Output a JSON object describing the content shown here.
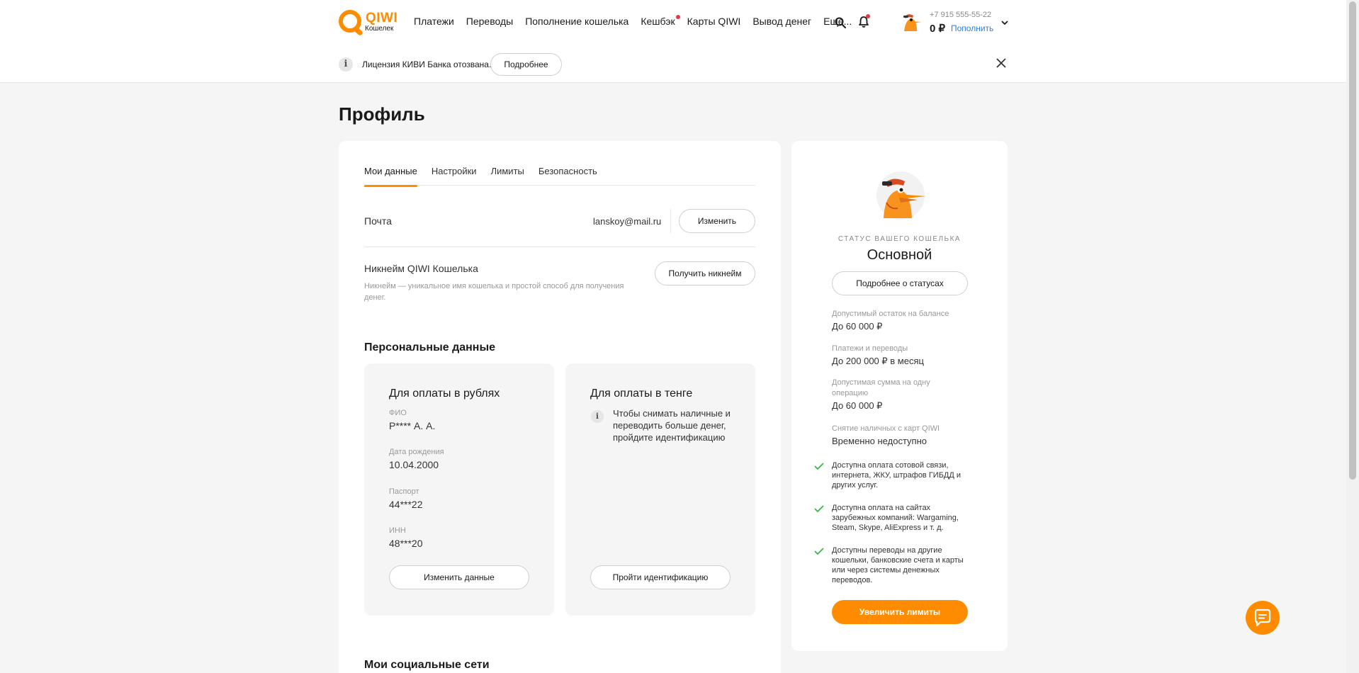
{
  "header": {
    "logo_text": "QIWI",
    "logo_sub": "Кошелек",
    "nav": [
      {
        "label": "Платежи",
        "dot": false
      },
      {
        "label": "Переводы",
        "dot": false
      },
      {
        "label": "Пополнение кошелька",
        "dot": false
      },
      {
        "label": "Кешбэк",
        "dot": true
      },
      {
        "label": "Карты QIWI",
        "dot": false
      },
      {
        "label": "Вывод денег",
        "dot": false
      },
      {
        "label": "Еще...",
        "dot": false
      }
    ],
    "search_icon": "search-icon",
    "bell_icon": "bell-icon",
    "phone": "+7 915 555-55-22",
    "balance": "0 ₽",
    "topup_label": "Пополнить"
  },
  "notice": {
    "text": "Лицензия КИВИ Банка отозвана.",
    "button": "Подробнее"
  },
  "page": {
    "title": "Профиль"
  },
  "tabs": [
    "Мои данные",
    "Настройки",
    "Лимиты",
    "Безопасность"
  ],
  "active_tab": "Мои данные",
  "email": {
    "label": "Почта",
    "value": "lanskoy@mail.ru",
    "button": "Изменить"
  },
  "nickname": {
    "label": "Никнейм QIWI Кошелька",
    "description": "Никнейм — уникальное имя кошелька и простой способ для получения денег.",
    "button": "Получить никнейм"
  },
  "personal": {
    "title": "Персональные данные",
    "rub": {
      "title": "Для оплаты в рублях",
      "fields": [
        {
          "label": "ФИО",
          "value": "Р**** А. А."
        },
        {
          "label": "Дата рождения",
          "value": "10.04.2000"
        },
        {
          "label": "Паспорт",
          "value": "44***22"
        },
        {
          "label": "ИНН",
          "value": "48***20"
        }
      ],
      "button": "Изменить данные"
    },
    "kzt": {
      "title": "Для оплаты в тенге",
      "info": "Чтобы снимать наличные и переводить больше денег, пройдите идентификацию",
      "button": "Пройти идентификацию"
    }
  },
  "social": {
    "title": "Мои социальные сети"
  },
  "status": {
    "caption": "СТАТУС ВАШЕГО КОШЕЛЬКА",
    "name": "Основной",
    "details_button": "Подробнее о статусах",
    "limits": [
      {
        "label": "Допустимый остаток на балансе",
        "value": "До 60 000 ₽"
      },
      {
        "label": "Платежи и переводы",
        "value": "До 200 000 ₽ в месяц"
      },
      {
        "label": "Допустимая сумма на одну операцию",
        "value": "До 60 000 ₽"
      },
      {
        "label": "Снятие наличных с карт QIWI",
        "value": "Временно недоступно"
      }
    ],
    "features": [
      "Доступна оплата сотовой связи, интернета, ЖКУ, штрафов ГИБДД и других услуг.",
      "Доступна оплата на сайтах зарубежных компаний: Wargaming, Steam, Skype, AliExpress и т. д.",
      "Доступны переводы на другие кошельки, банковские счета и карты или через системы денежных переводов."
    ],
    "increase_button": "Увеличить лимиты"
  },
  "colors": {
    "accent": "#ff8c00",
    "alert_dot": "#e6384a",
    "check": "#3bb54a",
    "link": "#2d7fd8"
  },
  "chat_icon": "chat-bubble-icon"
}
